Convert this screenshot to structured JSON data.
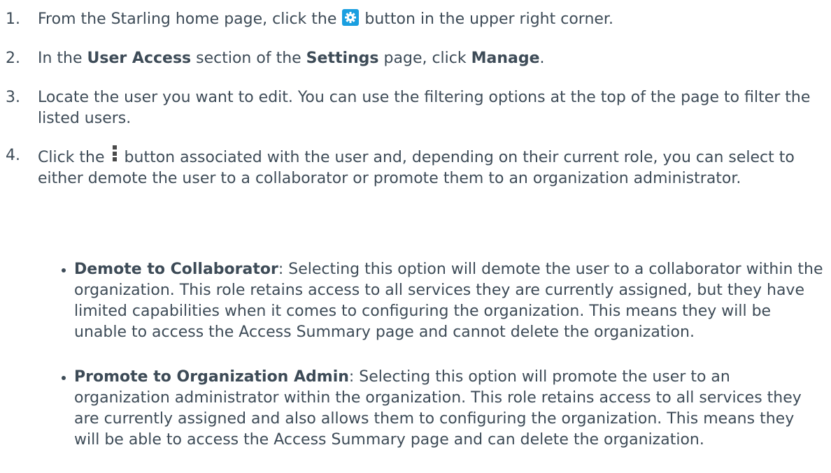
{
  "steps": [
    {
      "number": "1.",
      "text_a": "From the Starling home page, click the",
      "icon": "gear-icon",
      "text_b": "button in the upper right corner."
    },
    {
      "number": "2.",
      "text_a": "In the",
      "bold_a": "User Access",
      "text_b": "section of the",
      "bold_b": "Settings",
      "text_c": "page, click",
      "bold_c": "Manage",
      "text_d": "."
    },
    {
      "number": "3.",
      "text": "Locate the user you want to edit. You can use the filtering options at the top of the page to filter the listed users."
    },
    {
      "number": "4.",
      "text_a": "Click the",
      "icon": "kebab-menu-icon",
      "text_b": "button associated with the user and, depending on their current role, you can select to either demote the user to a collaborator or promote them to an organization administrator."
    }
  ],
  "options": [
    {
      "title": "Demote to Collaborator",
      "description": ": Selecting this option will demote the user to a collaborator within the organization. This role retains access to all services they are currently assigned, but they have limited capabilities when it comes to configuring the organization. This means they will be unable to access the Access Summary page and cannot delete the organization."
    },
    {
      "title": "Promote to Organization Admin",
      "description": ": Selecting this option will promote the user to an organization administrator within the organization. This role retains access to all services they are currently assigned and also allows them to configuring the organization. This means they will be able to access the Access Summary page and can delete the organization."
    }
  ],
  "colors": {
    "text": "#3d4b57",
    "gear_background": "#1a9fe0",
    "kebab": "#4a4a4a"
  }
}
